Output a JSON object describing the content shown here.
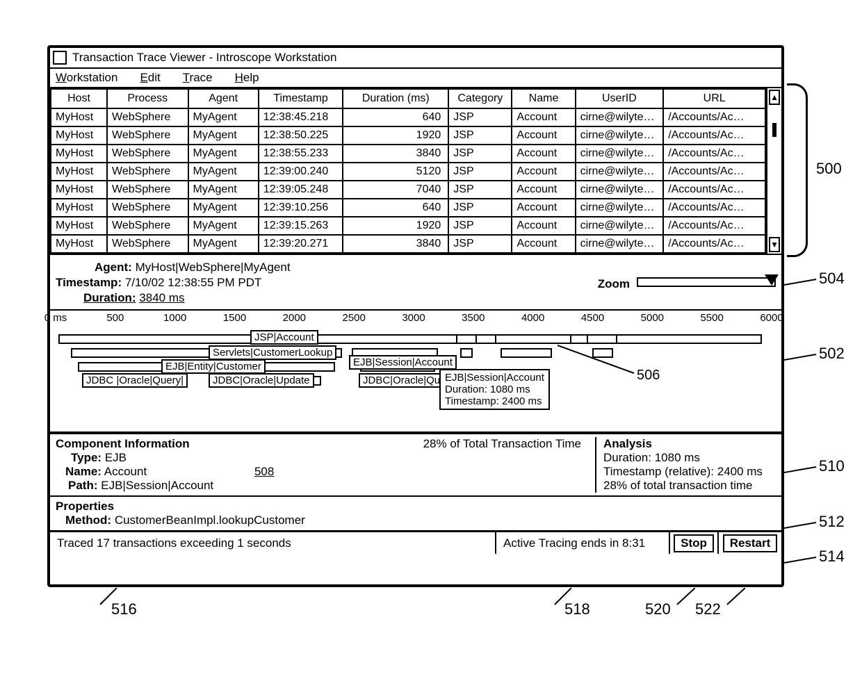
{
  "window": {
    "title": "Transaction Trace Viewer - Introscope Workstation"
  },
  "menu": {
    "workstation": "Workstation",
    "edit": "Edit",
    "trace": "Trace",
    "help": "Help"
  },
  "table": {
    "headers": {
      "host": "Host",
      "process": "Process",
      "agent": "Agent",
      "timestamp": "Timestamp",
      "duration": "Duration (ms)",
      "category": "Category",
      "name": "Name",
      "userid": "UserID",
      "url": "URL"
    },
    "rows": [
      {
        "host": "MyHost",
        "process": "WebSphere",
        "agent": "MyAgent",
        "timestamp": "12:38:45.218",
        "duration": "640",
        "category": "JSP",
        "name": "Account",
        "userid": "cirne@wilyte…",
        "url": "/Accounts/Ac…"
      },
      {
        "host": "MyHost",
        "process": "WebSphere",
        "agent": "MyAgent",
        "timestamp": "12:38:50.225",
        "duration": "1920",
        "category": "JSP",
        "name": "Account",
        "userid": "cirne@wilyte…",
        "url": "/Accounts/Ac…"
      },
      {
        "host": "MyHost",
        "process": "WebSphere",
        "agent": "MyAgent",
        "timestamp": "12:38:55.233",
        "duration": "3840",
        "category": "JSP",
        "name": "Account",
        "userid": "cirne@wilyte…",
        "url": "/Accounts/Ac…"
      },
      {
        "host": "MyHost",
        "process": "WebSphere",
        "agent": "MyAgent",
        "timestamp": "12:39:00.240",
        "duration": "5120",
        "category": "JSP",
        "name": "Account",
        "userid": "cirne@wilyte…",
        "url": "/Accounts/Ac…"
      },
      {
        "host": "MyHost",
        "process": "WebSphere",
        "agent": "MyAgent",
        "timestamp": "12:39:05.248",
        "duration": "7040",
        "category": "JSP",
        "name": "Account",
        "userid": "cirne@wilyte…",
        "url": "/Accounts/Ac…"
      },
      {
        "host": "MyHost",
        "process": "WebSphere",
        "agent": "MyAgent",
        "timestamp": "12:39:10.256",
        "duration": "640",
        "category": "JSP",
        "name": "Account",
        "userid": "cirne@wilyte…",
        "url": "/Accounts/Ac…"
      },
      {
        "host": "MyHost",
        "process": "WebSphere",
        "agent": "MyAgent",
        "timestamp": "12:39:15.263",
        "duration": "1920",
        "category": "JSP",
        "name": "Account",
        "userid": "cirne@wilyte…",
        "url": "/Accounts/Ac…"
      },
      {
        "host": "MyHost",
        "process": "WebSphere",
        "agent": "MyAgent",
        "timestamp": "12:39:20.271",
        "duration": "3840",
        "category": "JSP",
        "name": "Account",
        "userid": "cirne@wilyte…",
        "url": "/Accounts/Ac…"
      }
    ]
  },
  "detail": {
    "agent_label": "Agent:",
    "agent_value": "MyHost|WebSphere|MyAgent",
    "timestamp_label": "Timestamp:",
    "timestamp_value": "7/10/02 12:38:55 PM PDT",
    "duration_label": "Duration:",
    "duration_value": "3840 ms",
    "zoom_label": "Zoom"
  },
  "ruler": {
    "ticks": [
      "0 ms",
      "500",
      "1000",
      "1500",
      "2000",
      "2500",
      "3000",
      "3500",
      "4000",
      "4500",
      "5000",
      "5500",
      "6000"
    ]
  },
  "gantt": {
    "labels": {
      "jsp_account": "JSP|Account",
      "servlets_customerlookup": "Servlets|CustomerLookup",
      "ejb_entity_customer": "EJB|Entity|Customer",
      "jdbc_oracle_query": "JDBC  |Oracle|Query|",
      "jdbc_oracle_update": "JDBC|Oracle|Update",
      "ejb_session_account": "EJB|Session|Account",
      "jdbc_oracle_qu": "JDBC|Oracle|Qu"
    },
    "tooltip": {
      "line1": "EJB|Session|Account",
      "line2": "Duration: 1080 ms",
      "line3": "Timestamp: 2400 ms"
    }
  },
  "component_info": {
    "title": "Component Information",
    "pct": "28% of Total Transaction Time",
    "type_label": "Type:",
    "type_value": "EJB",
    "name_label": "Name:",
    "name_value": "Account",
    "path_label": "Path:",
    "path_value": "EJB|Session|Account",
    "ref508": "508",
    "analysis_title": "Analysis",
    "analysis_duration": "Duration: 1080 ms",
    "analysis_ts": "Timestamp (relative): 2400 ms",
    "analysis_pct": "28% of total transaction time"
  },
  "properties": {
    "title": "Properties",
    "method_label": "Method:",
    "method_value": "CustomerBeanImpl.lookupCustomer"
  },
  "status": {
    "traced": "Traced 17 transactions exceeding 1 seconds",
    "active": "Active Tracing ends in 8:31",
    "stop": "Stop",
    "restart": "Restart"
  },
  "callouts": {
    "c500": "500",
    "c502": "502",
    "c504": "504",
    "c506": "506",
    "c508": "508",
    "c510": "510",
    "c512": "512",
    "c514": "514",
    "c516": "516",
    "c518": "518",
    "c520": "520",
    "c522": "522"
  }
}
